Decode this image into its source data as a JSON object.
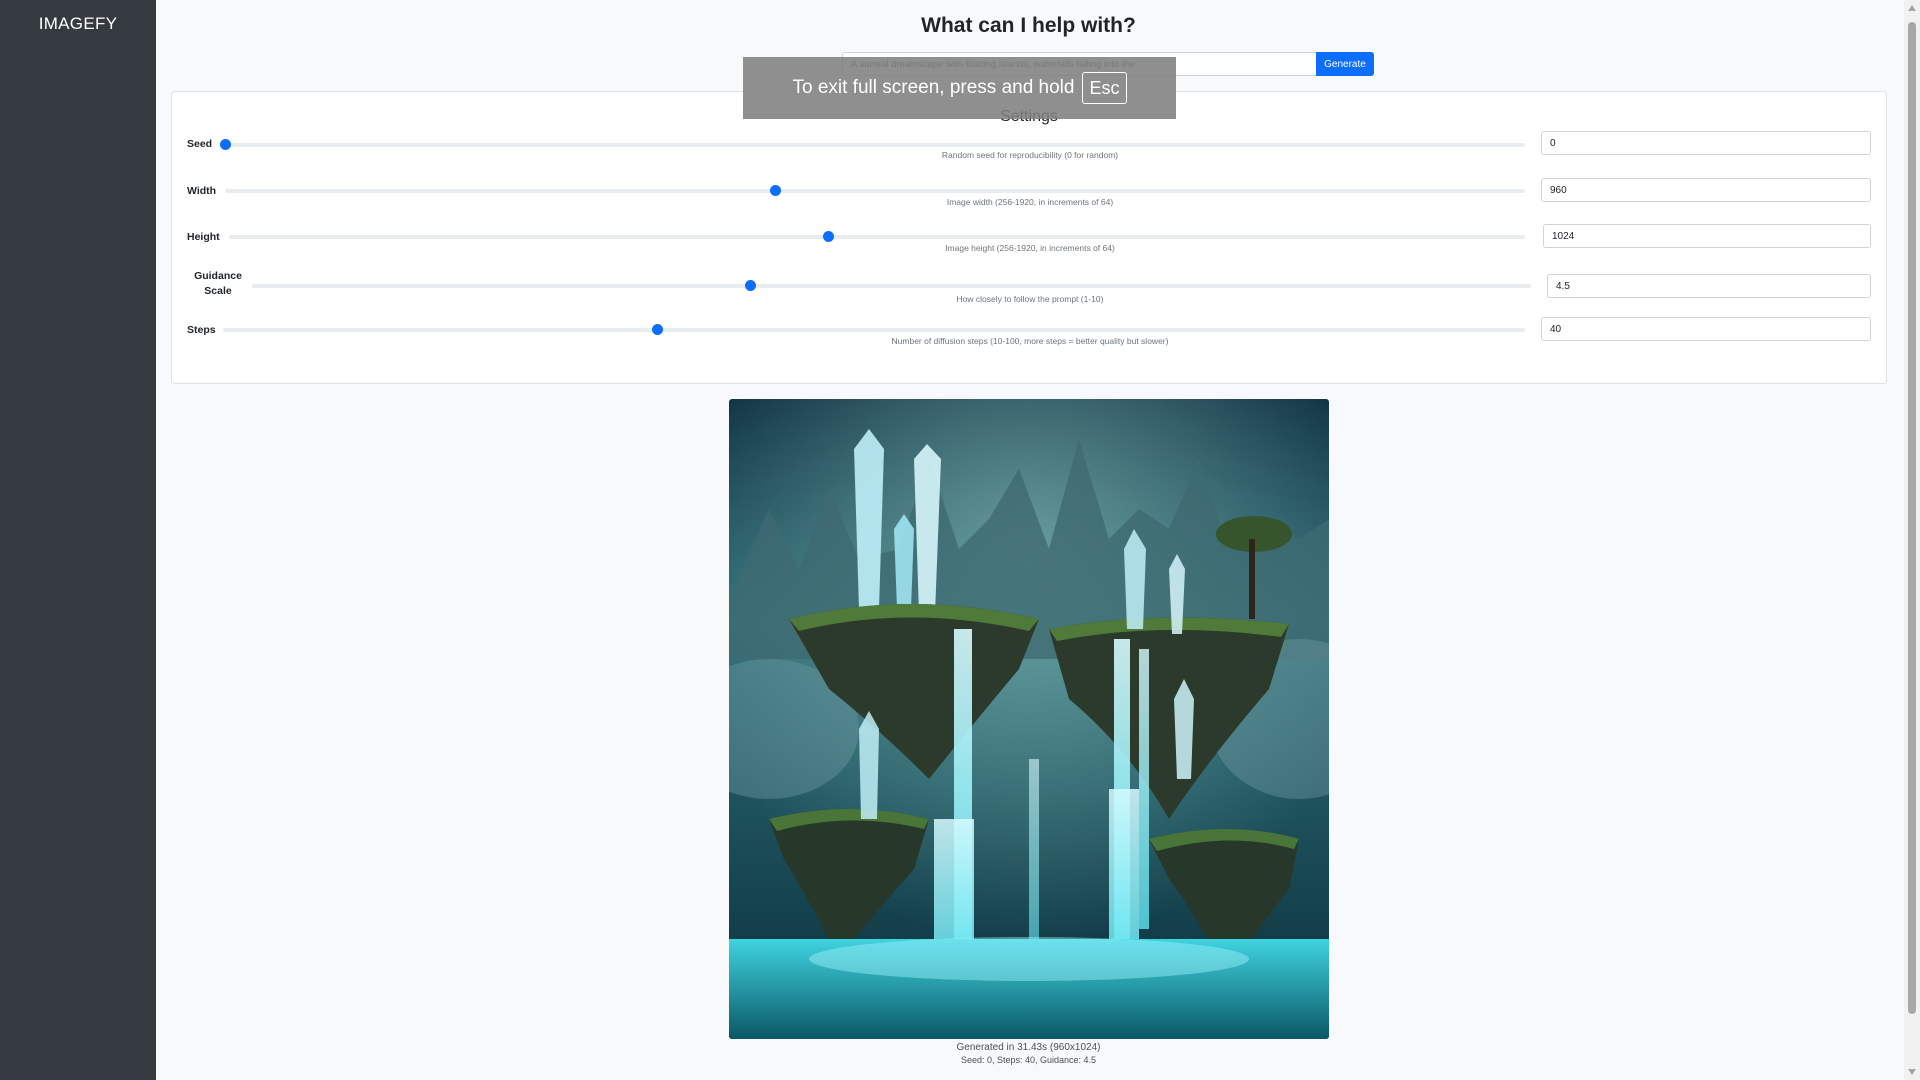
{
  "sidebar": {
    "brand": "IMAGEFY"
  },
  "header": {
    "title": "What can I help with?"
  },
  "prompt": {
    "value": "A surreal dreamscape with floating islands, waterfalls falling into the",
    "generate_label": "Generate"
  },
  "settings": {
    "title": "Settings",
    "seed": {
      "label": "Seed",
      "value": "0",
      "help": "Random seed for reproducibility (0 for random)",
      "slider_fraction": 0
    },
    "width": {
      "label": "Width",
      "value": "960",
      "help": "Image width (256-1920, in increments of 64)",
      "slider_fraction": 0.423
    },
    "height": {
      "label": "Height",
      "value": "1024",
      "help": "Image height (256-1920, in increments of 64)",
      "slider_fraction": 0.462
    },
    "guidance": {
      "label_line1": "Guidance",
      "label_line2": "Scale",
      "value": "4.5",
      "help": "How closely to follow the prompt (1-10)",
      "slider_fraction": 0.389
    },
    "steps": {
      "label": "Steps",
      "value": "40",
      "help": "Number of diffusion steps (10-100, more steps = better quality but slower)",
      "slider_fraction": 0.333
    }
  },
  "result": {
    "caption_line1": "Generated in 31.43s (960x1024)",
    "caption_line2": "Seed: 0, Steps: 40, Guidance: 4.5"
  },
  "fullscreen_notice": {
    "text": "To exit full screen, press and hold",
    "key": "Esc"
  },
  "colors": {
    "sidebar": "#343a40",
    "accent": "#0d6efd",
    "page_bg": "#f8f9fa"
  }
}
